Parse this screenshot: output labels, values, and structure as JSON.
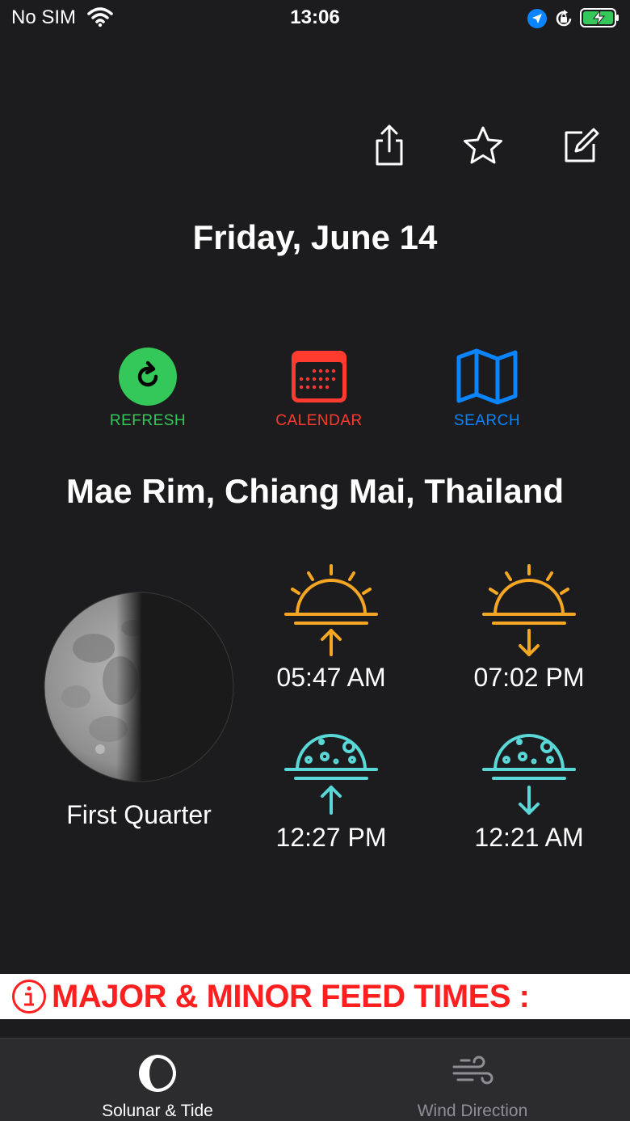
{
  "status_bar": {
    "carrier": "No SIM",
    "time": "13:06"
  },
  "header": {
    "date": "Friday, June 14"
  },
  "actions": {
    "refresh_label": "REFRESH",
    "calendar_label": "CALENDAR",
    "search_label": "SEARCH"
  },
  "location": {
    "name": "Mae Rim, Chiang Mai, Thailand"
  },
  "moon": {
    "phase": "First Quarter"
  },
  "events": {
    "sunrise": "05:47 AM",
    "sunset": "07:02 PM",
    "moonrise": "12:27 PM",
    "moonset": "12:21 AM"
  },
  "feed_banner": {
    "text": "MAJOR & MINOR FEED TIMES :"
  },
  "tabbar": {
    "solunar_label": "Solunar & Tide",
    "wind_label": "Wind Direction"
  },
  "colors": {
    "background": "#1c1c1e",
    "refresh": "#34c759",
    "calendar": "#ff3b30",
    "search": "#0a84ff",
    "sun": "#f5a623",
    "moon_event": "#5ad8d8",
    "feed_red": "#ff1f1f"
  },
  "icons": {
    "share": "share-icon",
    "favorite": "star-icon",
    "edit": "edit-icon",
    "refresh": "refresh-icon",
    "calendar": "calendar-icon",
    "search": "map-icon",
    "sunrise": "sunrise-icon",
    "sunset": "sunset-icon",
    "moonrise": "moonrise-icon",
    "moonset": "moonset-icon",
    "info": "info-icon",
    "solunar_tab": "moon-phase-icon",
    "wind_tab": "wind-icon"
  }
}
